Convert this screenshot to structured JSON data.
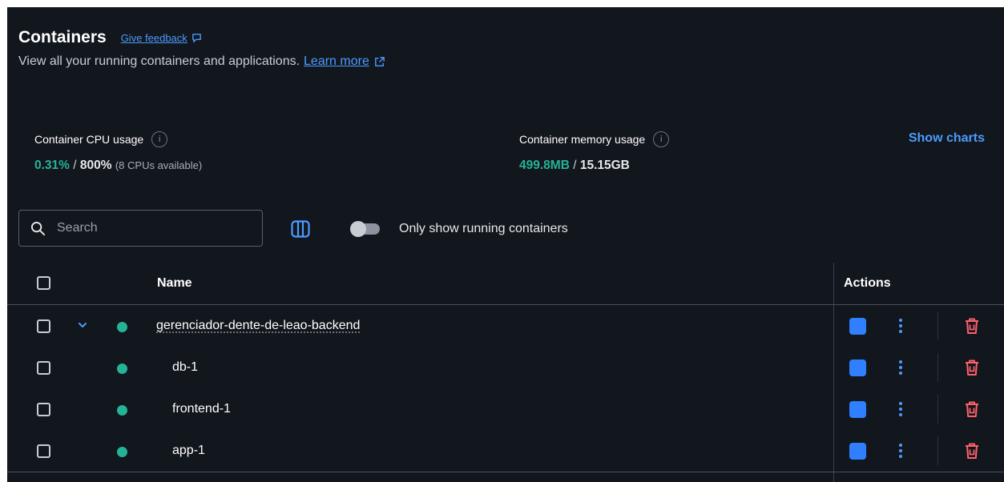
{
  "header": {
    "title": "Containers",
    "feedback_label": "Give feedback",
    "subtitle": "View all your running containers and applications.",
    "learn_more_label": "Learn more"
  },
  "stats": {
    "cpu": {
      "label": "Container CPU usage",
      "used": "0.31%",
      "separator": " / ",
      "total": "800%",
      "note": "(8 CPUs available)"
    },
    "memory": {
      "label": "Container memory usage",
      "used": "499.8MB",
      "separator": " / ",
      "total": "15.15GB"
    },
    "show_charts_label": "Show charts"
  },
  "toolbar": {
    "search_placeholder": "Search",
    "search_value": "",
    "toggle_label": "Only show running containers",
    "toggle_on": false
  },
  "table": {
    "columns": {
      "name": "Name",
      "actions": "Actions"
    },
    "rows": [
      {
        "name": "gerenciador-dente-de-leao-backend",
        "status": "running"
      },
      {
        "name": "db-1",
        "status": "running"
      },
      {
        "name": "frontend-1",
        "status": "running"
      },
      {
        "name": "app-1",
        "status": "running"
      }
    ]
  },
  "colors": {
    "background": "#12161d",
    "accent": "#4c9bff",
    "running": "#25b398",
    "stop_button": "#2f7fff",
    "delete": "#ff5f6d"
  },
  "icons": {
    "feedback": "feedback-icon",
    "external_link": "external-link-icon",
    "info": "info-icon",
    "search": "search-icon",
    "columns": "columns-icon",
    "chevron": "chevron-down-icon",
    "stop": "stop-icon",
    "more": "kebab-menu-icon",
    "delete": "trash-icon"
  }
}
